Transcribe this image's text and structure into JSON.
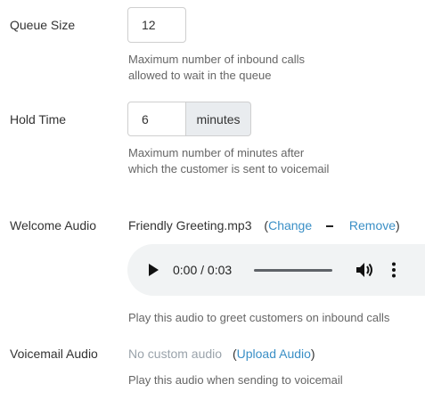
{
  "queue_size": {
    "label": "Queue Size",
    "value": "12",
    "help_line1": "Maximum number of inbound calls",
    "help_line2": "allowed to wait in the queue"
  },
  "hold_time": {
    "label": "Hold Time",
    "value": "6",
    "unit": "minutes",
    "help_line1": "Maximum number of minutes after",
    "help_line2": "which the customer is sent to voicemail"
  },
  "welcome_audio": {
    "label": "Welcome Audio",
    "filename": "Friendly Greeting.mp3",
    "open_paren": "(",
    "change_label": "Change",
    "remove_label": "Remove",
    "close_paren": ")",
    "player_time": "0:00 / 0:03",
    "help": "Play this audio to greet customers on inbound calls"
  },
  "voicemail_audio": {
    "label": "Voicemail Audio",
    "status": "No custom audio",
    "open_paren": "(",
    "upload_label": "Upload Audio",
    "close_paren": ")",
    "help": "Play this audio when sending to voicemail"
  },
  "colors": {
    "link": "#3a8fc6",
    "muted": "#9aa3ab",
    "player_bg": "#f1f3f4"
  },
  "icons": [
    "play-icon",
    "volume-icon",
    "more-options-icon"
  ]
}
